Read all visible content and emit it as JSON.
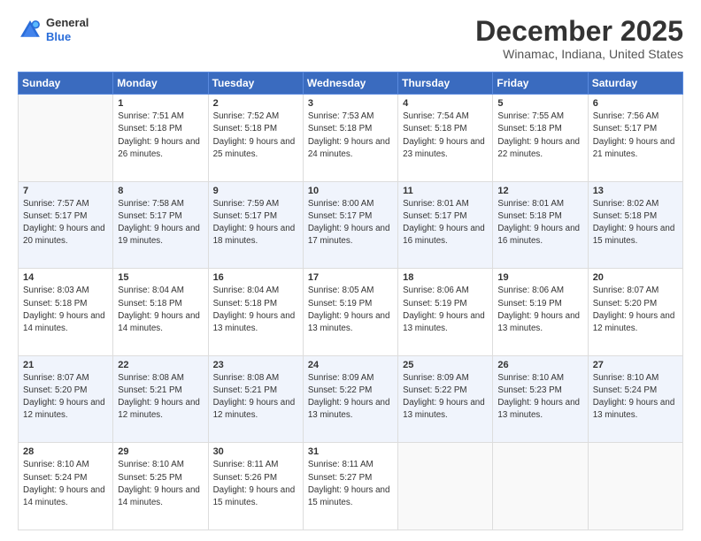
{
  "header": {
    "logo_general": "General",
    "logo_blue": "Blue",
    "title": "December 2025",
    "subtitle": "Winamac, Indiana, United States"
  },
  "weekdays": [
    "Sunday",
    "Monday",
    "Tuesday",
    "Wednesday",
    "Thursday",
    "Friday",
    "Saturday"
  ],
  "weeks": [
    [
      {
        "day": null
      },
      {
        "day": "1",
        "sunrise": "7:51 AM",
        "sunset": "5:18 PM",
        "daylight": "9 hours and 26 minutes."
      },
      {
        "day": "2",
        "sunrise": "7:52 AM",
        "sunset": "5:18 PM",
        "daylight": "9 hours and 25 minutes."
      },
      {
        "day": "3",
        "sunrise": "7:53 AM",
        "sunset": "5:18 PM",
        "daylight": "9 hours and 24 minutes."
      },
      {
        "day": "4",
        "sunrise": "7:54 AM",
        "sunset": "5:18 PM",
        "daylight": "9 hours and 23 minutes."
      },
      {
        "day": "5",
        "sunrise": "7:55 AM",
        "sunset": "5:18 PM",
        "daylight": "9 hours and 22 minutes."
      },
      {
        "day": "6",
        "sunrise": "7:56 AM",
        "sunset": "5:17 PM",
        "daylight": "9 hours and 21 minutes."
      }
    ],
    [
      {
        "day": "7",
        "sunrise": "7:57 AM",
        "sunset": "5:17 PM",
        "daylight": "9 hours and 20 minutes."
      },
      {
        "day": "8",
        "sunrise": "7:58 AM",
        "sunset": "5:17 PM",
        "daylight": "9 hours and 19 minutes."
      },
      {
        "day": "9",
        "sunrise": "7:59 AM",
        "sunset": "5:17 PM",
        "daylight": "9 hours and 18 minutes."
      },
      {
        "day": "10",
        "sunrise": "8:00 AM",
        "sunset": "5:17 PM",
        "daylight": "9 hours and 17 minutes."
      },
      {
        "day": "11",
        "sunrise": "8:01 AM",
        "sunset": "5:17 PM",
        "daylight": "9 hours and 16 minutes."
      },
      {
        "day": "12",
        "sunrise": "8:01 AM",
        "sunset": "5:18 PM",
        "daylight": "9 hours and 16 minutes."
      },
      {
        "day": "13",
        "sunrise": "8:02 AM",
        "sunset": "5:18 PM",
        "daylight": "9 hours and 15 minutes."
      }
    ],
    [
      {
        "day": "14",
        "sunrise": "8:03 AM",
        "sunset": "5:18 PM",
        "daylight": "9 hours and 14 minutes."
      },
      {
        "day": "15",
        "sunrise": "8:04 AM",
        "sunset": "5:18 PM",
        "daylight": "9 hours and 14 minutes."
      },
      {
        "day": "16",
        "sunrise": "8:04 AM",
        "sunset": "5:18 PM",
        "daylight": "9 hours and 13 minutes."
      },
      {
        "day": "17",
        "sunrise": "8:05 AM",
        "sunset": "5:19 PM",
        "daylight": "9 hours and 13 minutes."
      },
      {
        "day": "18",
        "sunrise": "8:06 AM",
        "sunset": "5:19 PM",
        "daylight": "9 hours and 13 minutes."
      },
      {
        "day": "19",
        "sunrise": "8:06 AM",
        "sunset": "5:19 PM",
        "daylight": "9 hours and 13 minutes."
      },
      {
        "day": "20",
        "sunrise": "8:07 AM",
        "sunset": "5:20 PM",
        "daylight": "9 hours and 12 minutes."
      }
    ],
    [
      {
        "day": "21",
        "sunrise": "8:07 AM",
        "sunset": "5:20 PM",
        "daylight": "9 hours and 12 minutes."
      },
      {
        "day": "22",
        "sunrise": "8:08 AM",
        "sunset": "5:21 PM",
        "daylight": "9 hours and 12 minutes."
      },
      {
        "day": "23",
        "sunrise": "8:08 AM",
        "sunset": "5:21 PM",
        "daylight": "9 hours and 12 minutes."
      },
      {
        "day": "24",
        "sunrise": "8:09 AM",
        "sunset": "5:22 PM",
        "daylight": "9 hours and 13 minutes."
      },
      {
        "day": "25",
        "sunrise": "8:09 AM",
        "sunset": "5:22 PM",
        "daylight": "9 hours and 13 minutes."
      },
      {
        "day": "26",
        "sunrise": "8:10 AM",
        "sunset": "5:23 PM",
        "daylight": "9 hours and 13 minutes."
      },
      {
        "day": "27",
        "sunrise": "8:10 AM",
        "sunset": "5:24 PM",
        "daylight": "9 hours and 13 minutes."
      }
    ],
    [
      {
        "day": "28",
        "sunrise": "8:10 AM",
        "sunset": "5:24 PM",
        "daylight": "9 hours and 14 minutes."
      },
      {
        "day": "29",
        "sunrise": "8:10 AM",
        "sunset": "5:25 PM",
        "daylight": "9 hours and 14 minutes."
      },
      {
        "day": "30",
        "sunrise": "8:11 AM",
        "sunset": "5:26 PM",
        "daylight": "9 hours and 15 minutes."
      },
      {
        "day": "31",
        "sunrise": "8:11 AM",
        "sunset": "5:27 PM",
        "daylight": "9 hours and 15 minutes."
      },
      {
        "day": null
      },
      {
        "day": null
      },
      {
        "day": null
      }
    ]
  ]
}
